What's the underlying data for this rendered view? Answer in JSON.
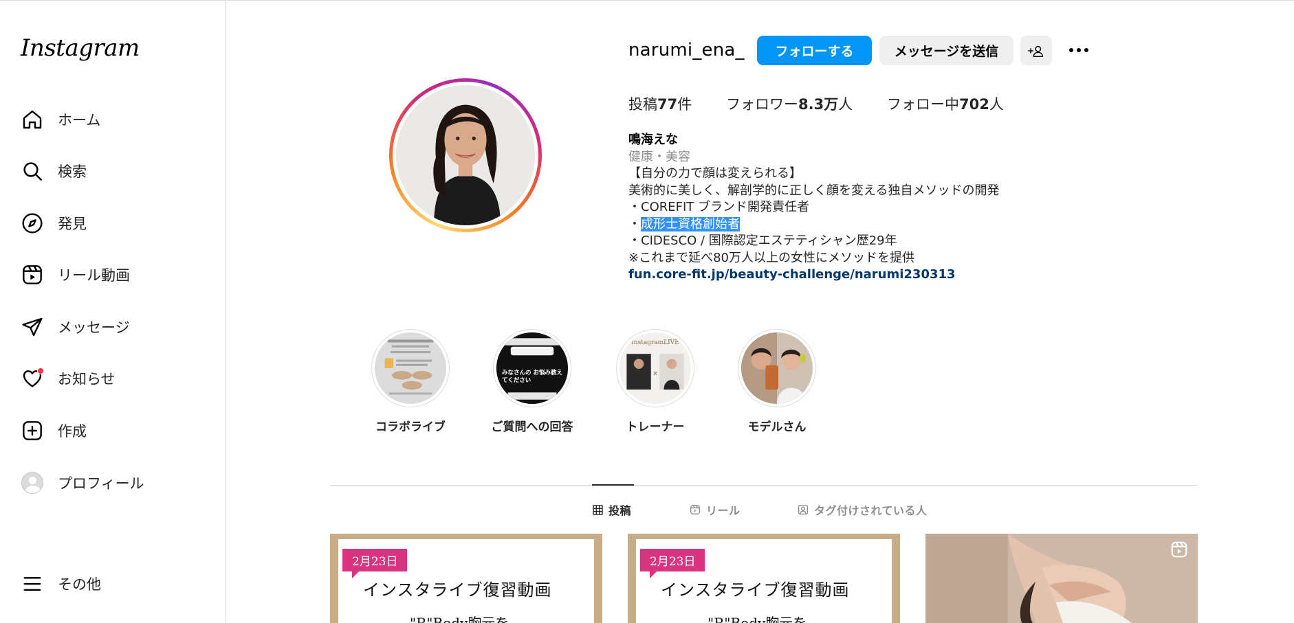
{
  "app": {
    "logo_text": "Instagram"
  },
  "sidebar": {
    "items": [
      {
        "label": "ホーム",
        "icon": "home-icon"
      },
      {
        "label": "検索",
        "icon": "search-icon"
      },
      {
        "label": "発見",
        "icon": "compass-icon"
      },
      {
        "label": "リール動画",
        "icon": "reels-icon"
      },
      {
        "label": "メッセージ",
        "icon": "send-icon"
      },
      {
        "label": "お知らせ",
        "icon": "heart-icon"
      },
      {
        "label": "作成",
        "icon": "plus-square-icon"
      },
      {
        "label": "プロフィール",
        "icon": "avatar"
      }
    ],
    "more_label": "その他"
  },
  "profile": {
    "username": "narumi_ena_",
    "follow_label": "フォローする",
    "message_label": "メッセージを送信",
    "add_user_label": "+⁠",
    "stats": {
      "posts_prefix": "投稿",
      "posts_value": "77",
      "posts_suffix": "件",
      "followers_prefix": "フォロワー",
      "followers_value": "8.3万",
      "followers_suffix": "人",
      "following_prefix": "フォロー中",
      "following_value": "702",
      "following_suffix": "人"
    },
    "bio": {
      "name": "鳴海えな",
      "category": "健康・美容",
      "line1": "【自分の力で顔は変えられる】",
      "line2": "美術的に美しく、解剖学的に正しく顔を変える独自メソッドの開発",
      "line3": "・COREFIT ブランド開発責任者",
      "line4_prefix": "・",
      "line4_highlight": "成形士資格創始者",
      "line5": "・CIDESCO / 国際認定エステティシャン歴29年",
      "line6": "※これまで延べ80万人以上の女性にメソッドを提供",
      "link": "fun.core-fit.jp/beauty-challenge/narumi230313"
    }
  },
  "highlights": [
    {
      "label": "コラボライブ"
    },
    {
      "label": "ご質問への回答",
      "inner_text": "みなさんの お悩み教えてください"
    },
    {
      "label": "トレーナー",
      "inner_title": "InstagramLIVE"
    },
    {
      "label": "モデルさん"
    }
  ],
  "tabs": [
    {
      "label": "投稿",
      "icon": "grid-icon",
      "active": true
    },
    {
      "label": "リール",
      "icon": "reels-icon",
      "active": false
    },
    {
      "label": "タグ付けされている人",
      "icon": "tagged-icon",
      "active": false
    }
  ],
  "posts": [
    {
      "date": "2月23日",
      "title": "インスタライブ復習動画",
      "subtitle": "\"R\"Body胸元を"
    },
    {
      "date": "2月23日",
      "title": "インスタライブ復習動画",
      "subtitle": "\"R\"Body胸元を"
    },
    {
      "type": "reel-photo"
    }
  ],
  "colors": {
    "accent": "#0095f6",
    "link": "#00376b",
    "notification": "#ff3040",
    "highlight": "#3390ff",
    "badge": "#d9347f"
  }
}
